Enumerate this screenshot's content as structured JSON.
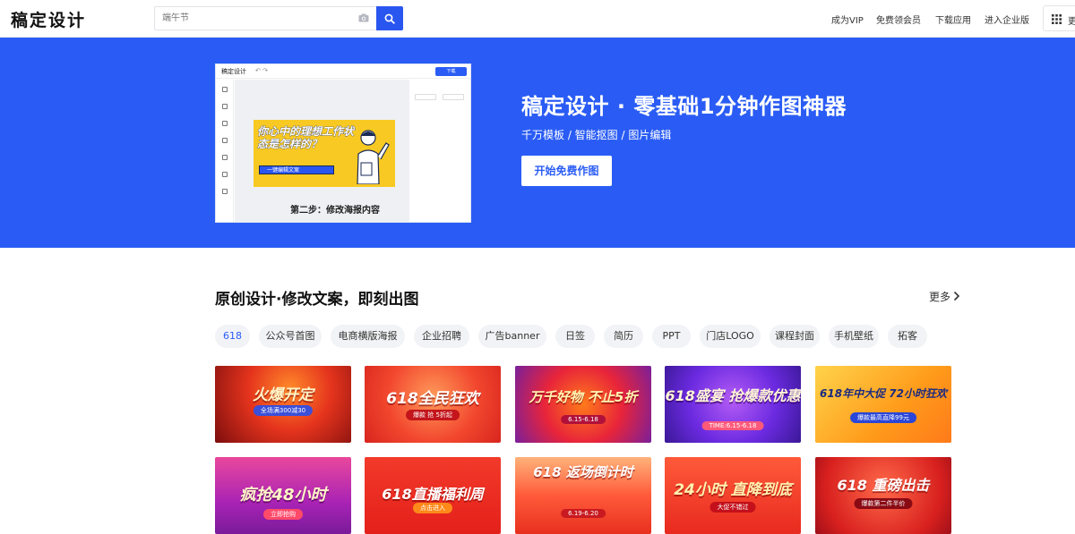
{
  "header": {
    "logo": "稿定设计",
    "search_placeholder": "端午节",
    "nav": [
      "成为VIP",
      "免费领会员",
      "下载应用",
      "进入企业版"
    ],
    "more_label": "更"
  },
  "hero": {
    "mockup": {
      "app_title": "稿定设计",
      "download_label": "下载",
      "poster_heading": "你心中的理想工作状态是怎样的？",
      "poster_button": "一键编辑文案",
      "step_text": "第二步：修改海报内容"
    },
    "title": "稿定设计 · 零基础1分钟作图神器",
    "subtitle": "千万模板 / 智能抠图 / 图片编辑",
    "cta": "开始免费作图"
  },
  "section": {
    "title": "原创设计·修改文案，即刻出图",
    "more": "更多"
  },
  "categories": [
    "618",
    "公众号首图",
    "电商横版海报",
    "企业招聘",
    "广告banner",
    "日签",
    "简历",
    "PPT",
    "门店LOGO",
    "课程封面",
    "手机壁纸",
    "拓客"
  ],
  "templates": [
    {
      "title": "火爆开定",
      "sub": "全场满300减30"
    },
    {
      "title": "618全民狂欢",
      "sub": "爆款 抢 5折起"
    },
    {
      "title": "万千好物 不止5折",
      "sub": "6.15-6.18"
    },
    {
      "title": "618盛宴 抢爆款优惠",
      "sub": "TIME:6.15-6.18"
    },
    {
      "title": "618年中大促 72小时狂欢",
      "sub": "爆款最高直降99元"
    },
    {
      "title": "疯抢48小时",
      "sub": "立即抢购"
    },
    {
      "title": "618直播福利周",
      "sub": "点击进入"
    },
    {
      "title": "618 返场倒计时",
      "sub": "6.19-6.20"
    },
    {
      "title": "24小时 直降到底",
      "sub": "大促不错过"
    },
    {
      "title": "618 重磅出击",
      "sub": "爆款第二件半价"
    }
  ],
  "colors": {
    "brand_blue": "#2a5cf5",
    "search_blue": "#2a56f0"
  }
}
